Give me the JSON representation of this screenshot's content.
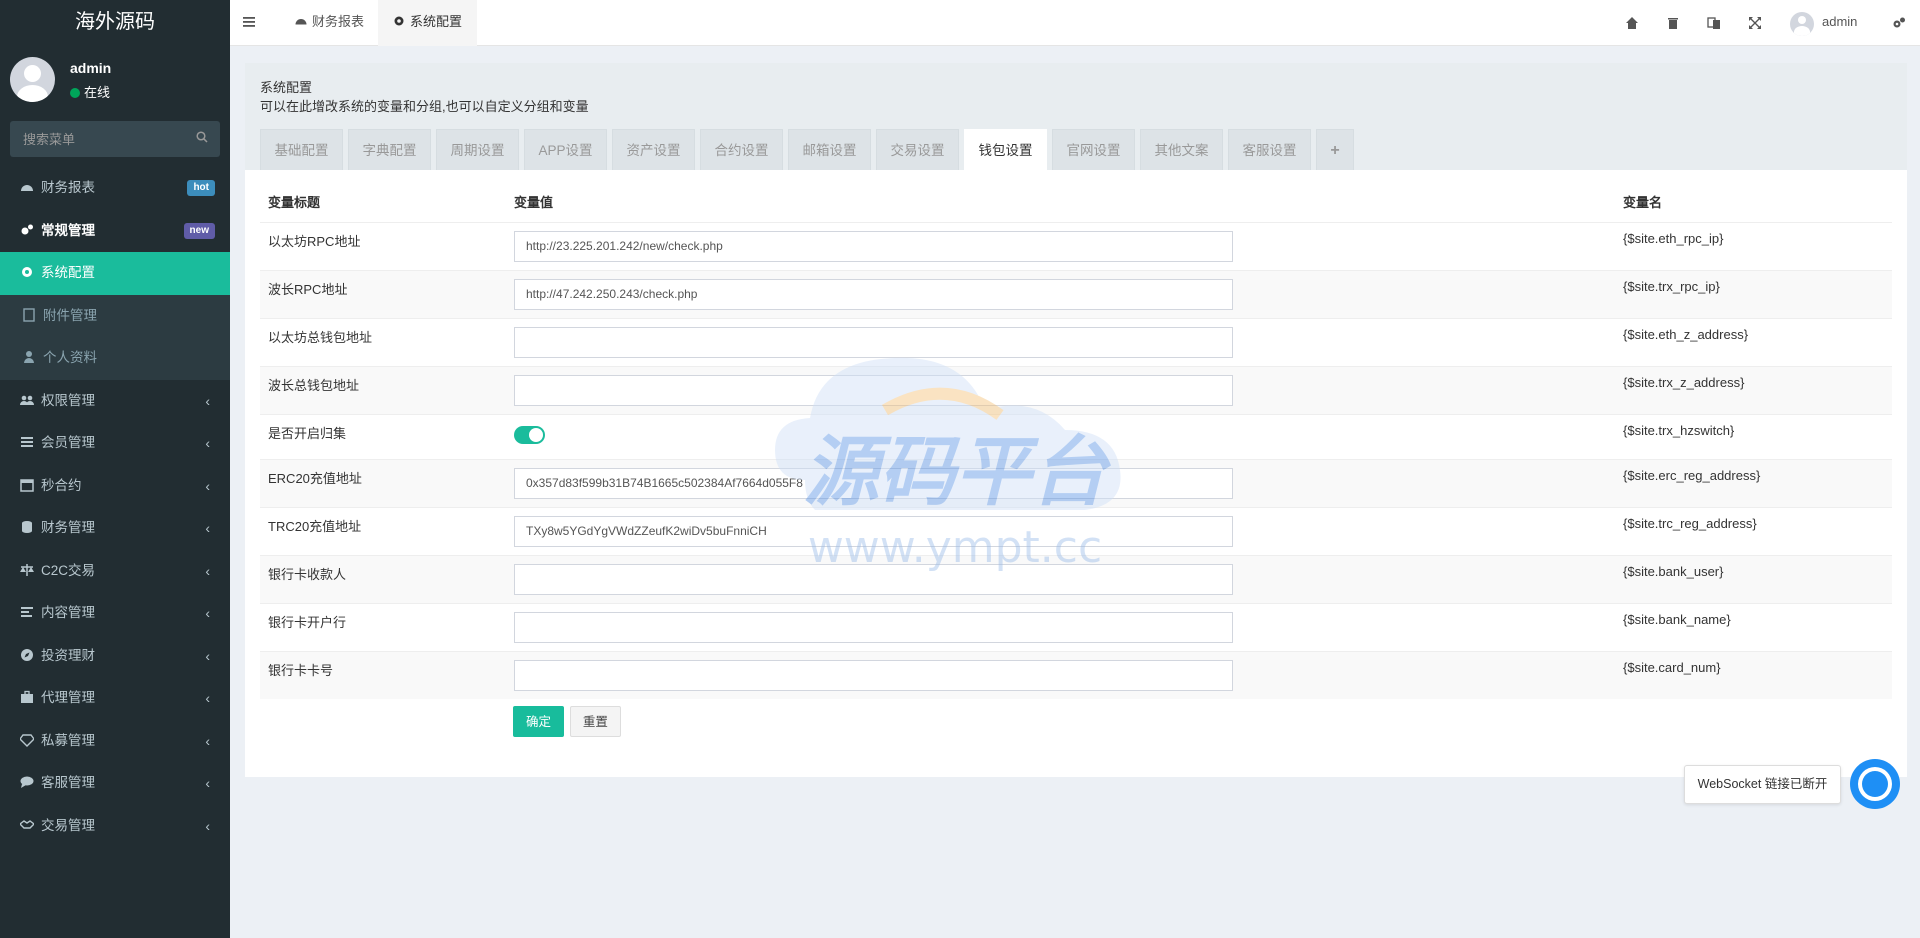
{
  "sidebar": {
    "logo": "海外源码",
    "user": {
      "name": "admin",
      "status": "在线"
    },
    "search_placeholder": "搜索菜单",
    "items": [
      {
        "label": "财务报表",
        "icon": "dashboard-icon",
        "badge": "hot"
      },
      {
        "label": "常规管理",
        "icon": "cogs-icon",
        "badge": "new"
      },
      {
        "label": "系统配置",
        "icon": "gear-icon"
      },
      {
        "label": "附件管理",
        "icon": "file-image-icon"
      },
      {
        "label": "个人资料",
        "icon": "user-icon"
      },
      {
        "label": "权限管理",
        "icon": "group-icon"
      },
      {
        "label": "会员管理",
        "icon": "list-icon"
      },
      {
        "label": "秒合约",
        "icon": "calendar-icon"
      },
      {
        "label": "财务管理",
        "icon": "database-icon"
      },
      {
        "label": "C2C交易",
        "icon": "balance-scale-icon"
      },
      {
        "label": "内容管理",
        "icon": "align-left-icon"
      },
      {
        "label": "投资理财",
        "icon": "compass-icon"
      },
      {
        "label": "代理管理",
        "icon": "briefcase-icon"
      },
      {
        "label": "私募管理",
        "icon": "diamond-icon"
      },
      {
        "label": "客服管理",
        "icon": "comment-icon"
      },
      {
        "label": "交易管理",
        "icon": "handshake-icon"
      }
    ]
  },
  "header": {
    "tabs": [
      {
        "label": "财务报表",
        "icon": "dashboard-icon"
      },
      {
        "label": "系统配置",
        "icon": "gear-icon"
      }
    ],
    "user": "admin"
  },
  "config": {
    "title": "系统配置",
    "subtitle": "可以在此增改系统的变量和分组,也可以自定义分组和变量",
    "tabs": [
      "基础配置",
      "字典配置",
      "周期设置",
      "APP设置",
      "资产设置",
      "合约设置",
      "邮箱设置",
      "交易设置",
      "钱包设置",
      "官网设置",
      "其他文案",
      "客服设置",
      "+"
    ],
    "active_tab": "钱包设置",
    "columns": {
      "title": "变量标题",
      "value": "变量值",
      "name": "变量名"
    },
    "rows": [
      {
        "title": "以太坊RPC地址",
        "value": "http://23.225.201.242/new/check.php",
        "name": "{$site.eth_rpc_ip}"
      },
      {
        "title": "波长RPC地址",
        "value": "http://47.242.250.243/check.php",
        "name": "{$site.trx_rpc_ip}"
      },
      {
        "title": "以太坊总钱包地址",
        "value": "",
        "name": "{$site.eth_z_address}"
      },
      {
        "title": "波长总钱包地址",
        "value": "",
        "name": "{$site.trx_z_address}"
      },
      {
        "title": "是否开启归集",
        "value": "",
        "name": "{$site.trx_hzswitch}"
      },
      {
        "title": "ERC20充值地址",
        "value": "0x357d83f599b31B74B1665c502384Af7664d055F8",
        "name": "{$site.erc_reg_address}"
      },
      {
        "title": "TRC20充值地址",
        "value": "TXy8w5YGdYgVWdZZeufK2wiDv5buFnniCH",
        "name": "{$site.trc_reg_address}"
      },
      {
        "title": "银行卡收款人",
        "value": "",
        "name": "{$site.bank_user}"
      },
      {
        "title": "银行卡开户行",
        "value": "",
        "name": "{$site.bank_name}"
      },
      {
        "title": "银行卡卡号",
        "value": "",
        "name": "{$site.card_num}"
      }
    ],
    "submit": "确定",
    "reset": "重置"
  },
  "watermark": {
    "cn": "源码平台",
    "url": "www.ympt.cc"
  },
  "websocket_tip": "WebSocket 链接已断开",
  "colors": {
    "accent": "#1abc9c",
    "sidebar": "#222d32"
  }
}
